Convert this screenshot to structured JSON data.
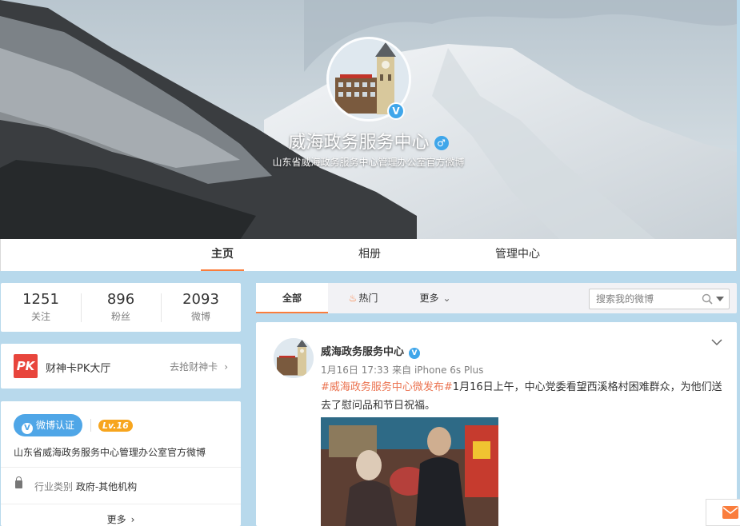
{
  "profile": {
    "name": "威海政务服务中心",
    "description": "山东省威海政务服务中心管理办公室官方微博"
  },
  "nav": {
    "tabs": [
      "主页",
      "相册",
      "管理中心"
    ]
  },
  "stats": [
    {
      "value": "1251",
      "label": "关注"
    },
    {
      "value": "896",
      "label": "粉丝"
    },
    {
      "value": "2093",
      "label": "微博"
    }
  ],
  "pk": {
    "logo_text": "PK",
    "title": "财神卡PK大厅",
    "link": "去抢财神卡"
  },
  "info": {
    "verify_label": "微博认证",
    "level": "Lv.16",
    "description": "山东省威海政务服务中心管理办公室官方微博",
    "industry_key": "行业类别",
    "industry_value": "政府-其他机构",
    "more": "更多"
  },
  "feed_tabs": {
    "all": "全部",
    "hot": "热门",
    "more": "更多"
  },
  "search": {
    "placeholder": "搜索我的微博"
  },
  "post": {
    "author": "威海政务服务中心",
    "time": "1月16日 17:33",
    "source": "来自 iPhone 6s Plus",
    "tag": "#威海政务服务中心微发布#",
    "text": "1月16日上午，中心党委看望西溪格村困难群众，为他们送去了慰问品和节日祝福。"
  },
  "colors": {
    "accent": "#fa7d3c",
    "link": "#eb7350",
    "verify_blue": "#4fa6e7",
    "page_bg": "#b8d9ec"
  },
  "icons": [
    "verified-icon",
    "gender-male-icon",
    "fire-icon",
    "chevron-down-icon",
    "search-icon",
    "lock-icon",
    "chevron-right-icon",
    "mail-icon"
  ]
}
